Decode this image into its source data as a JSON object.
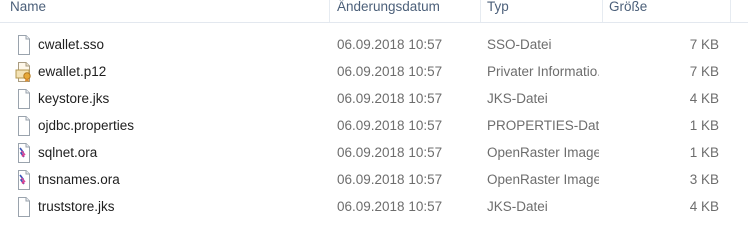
{
  "columns": {
    "name": "Name",
    "date": "Änderungsdatum",
    "type": "Typ",
    "size": "Größe"
  },
  "files": [
    {
      "name": "cwallet.sso",
      "date": "06.09.2018 10:57",
      "type": "SSO-Datei",
      "size": "7 KB",
      "icon": "generic-file-icon"
    },
    {
      "name": "ewallet.p12",
      "date": "06.09.2018 10:57",
      "type": "Privater Informatio...",
      "size": "7 KB",
      "icon": "certificate-file-icon"
    },
    {
      "name": "keystore.jks",
      "date": "06.09.2018 10:57",
      "type": "JKS-Datei",
      "size": "4 KB",
      "icon": "generic-file-icon"
    },
    {
      "name": "ojdbc.properties",
      "date": "06.09.2018 10:57",
      "type": "PROPERTIES-Datei",
      "size": "1 KB",
      "icon": "generic-file-icon"
    },
    {
      "name": "sqlnet.ora",
      "date": "06.09.2018 10:57",
      "type": "OpenRaster Image...",
      "size": "1 KB",
      "icon": "openraster-file-icon"
    },
    {
      "name": "tnsnames.ora",
      "date": "06.09.2018 10:57",
      "type": "OpenRaster Image...",
      "size": "3 KB",
      "icon": "openraster-file-icon"
    },
    {
      "name": "truststore.jks",
      "date": "06.09.2018 10:57",
      "type": "JKS-Datei",
      "size": "4 KB",
      "icon": "generic-file-icon"
    }
  ]
}
